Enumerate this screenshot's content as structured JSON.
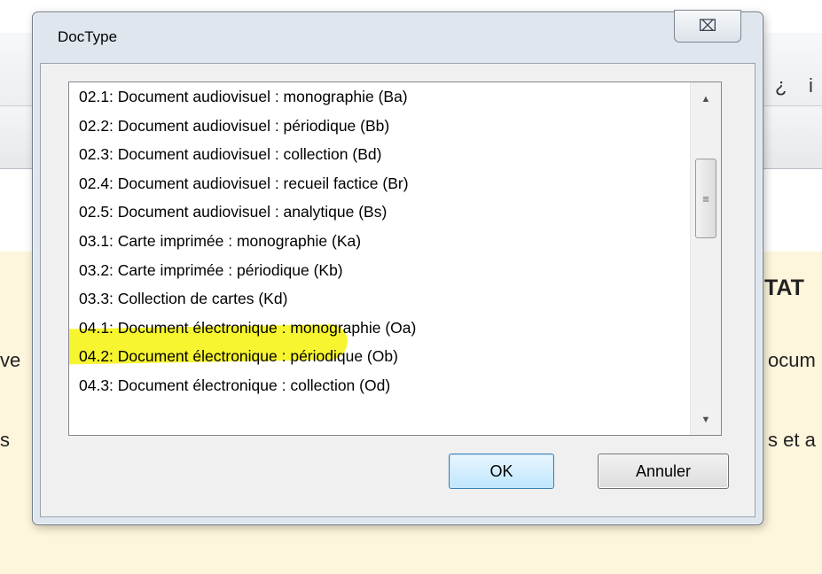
{
  "dialog": {
    "title": "DocType",
    "close_glyph": "⌧",
    "items": [
      "02.1: Document audiovisuel : monographie (Ba)",
      "02.2: Document audiovisuel : périodique (Bb)",
      "02.3: Document audiovisuel : collection (Bd)",
      "02.4: Document audiovisuel : recueil factice (Br)",
      "02.5: Document audiovisuel : analytique (Bs)",
      "03.1: Carte imprimée : monographie (Ka)",
      "03.2: Carte imprimée : périodique (Kb)",
      "03.3: Collection de cartes (Kd)",
      "04.1: Document électronique : monographie (Oa)",
      "04.2: Document électronique : périodique (Ob)",
      "04.3: Document électronique : collection (Od)"
    ],
    "highlighted_item": "03.3: Collection de cartes (Kd)",
    "ok_label": "OK",
    "cancel_label": "Annuler",
    "scroll_up_glyph": "▲",
    "scroll_down_glyph": "▼",
    "scroll_grip_glyph": "≡",
    "highlight_color": "#f7f530"
  },
  "background": {
    "toolbar_glyphs": [
      "¿",
      "i"
    ],
    "fragment_tat": "TAT",
    "fragment_ve": "ve",
    "fragment_ocum": "ocum",
    "fragment_s": "s",
    "fragment_s_et": "s et a"
  }
}
